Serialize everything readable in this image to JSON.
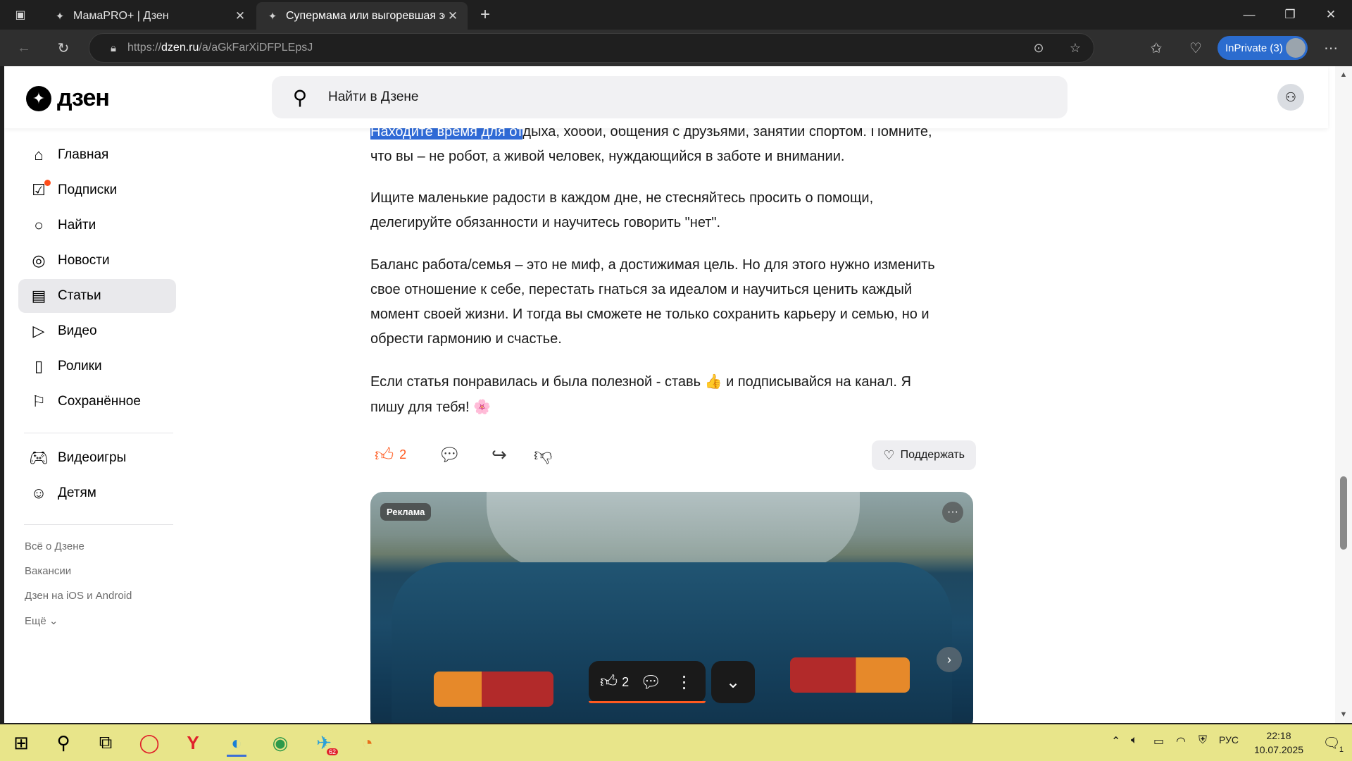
{
  "browser": {
    "tabs": [
      {
        "title": "МамаPRO+ | Дзен",
        "active": false
      },
      {
        "title": "Супермама или выгоревшая зо",
        "active": true
      }
    ],
    "new_tab_label": "+",
    "url_prefix": "https://",
    "url_domain": "dzen.ru",
    "url_path": "/a/aGkFarXiDFPLEpsJ",
    "inprivate_label": "InPrivate (3)"
  },
  "header": {
    "logo_text": "дзен",
    "search_placeholder": "Найти в Дзене"
  },
  "sidebar": {
    "items": [
      {
        "label": "Главная",
        "icon": "home-icon"
      },
      {
        "label": "Подписки",
        "icon": "subscriptions-icon"
      },
      {
        "label": "Найти",
        "icon": "search-icon"
      },
      {
        "label": "Новости",
        "icon": "news-icon"
      },
      {
        "label": "Статьи",
        "icon": "articles-icon",
        "active": true
      },
      {
        "label": "Видео",
        "icon": "video-icon"
      },
      {
        "label": "Ролики",
        "icon": "shorts-icon"
      },
      {
        "label": "Сохранённое",
        "icon": "bookmark-icon"
      },
      {
        "label": "Видеоигры",
        "icon": "gamepad-icon"
      },
      {
        "label": "Детям",
        "icon": "kids-icon"
      }
    ],
    "footer_links": [
      "Всё о Дзене",
      "Вакансии",
      "Дзен на iOS и Android",
      "Ещё"
    ]
  },
  "article": {
    "p1_selected": "Находите время для от",
    "p1_rest_line1": "дыха, хобби, общения с друзьями, занятий спортом. Помните,",
    "p1_line2": "что вы – не робот, а живой человек, нуждающийся в заботе и внимании.",
    "p2_line1": "Ищите маленькие радости в каждом дне, не стесняйтесь просить о помощи,",
    "p2_line2": "делегируйте обязанности и научитесь говорить \"нет\".",
    "p3_line1": "Баланс работа/семья – это не миф, а достижимая цель. Но для этого нужно изменить",
    "p3_line2": "свое отношение к себе, перестать гнаться за идеалом и научиться ценить каждый",
    "p3_line3": "момент своей жизни. И тогда вы сможете не только сохранить карьеру и семью, но и",
    "p3_line4": "обрести гармонию и счастье.",
    "p4_line1a": "Если статья понравилась и была полезной - ставь ",
    "p4_emoji1": "👍",
    "p4_line1b": " и подписывайся на канал. Я",
    "p4_line2": "пишу для тебя! ",
    "p4_emoji2": "🌸"
  },
  "actions": {
    "like_count": "2",
    "support_label": "Поддержать"
  },
  "ad": {
    "badge": "Реклама",
    "more": "···"
  },
  "floating_bar": {
    "like_count": "2"
  },
  "taskbar": {
    "language": "РУС",
    "time": "22:18",
    "date": "10.07.2025",
    "notification_count": "1",
    "telegram_badge": "62"
  }
}
